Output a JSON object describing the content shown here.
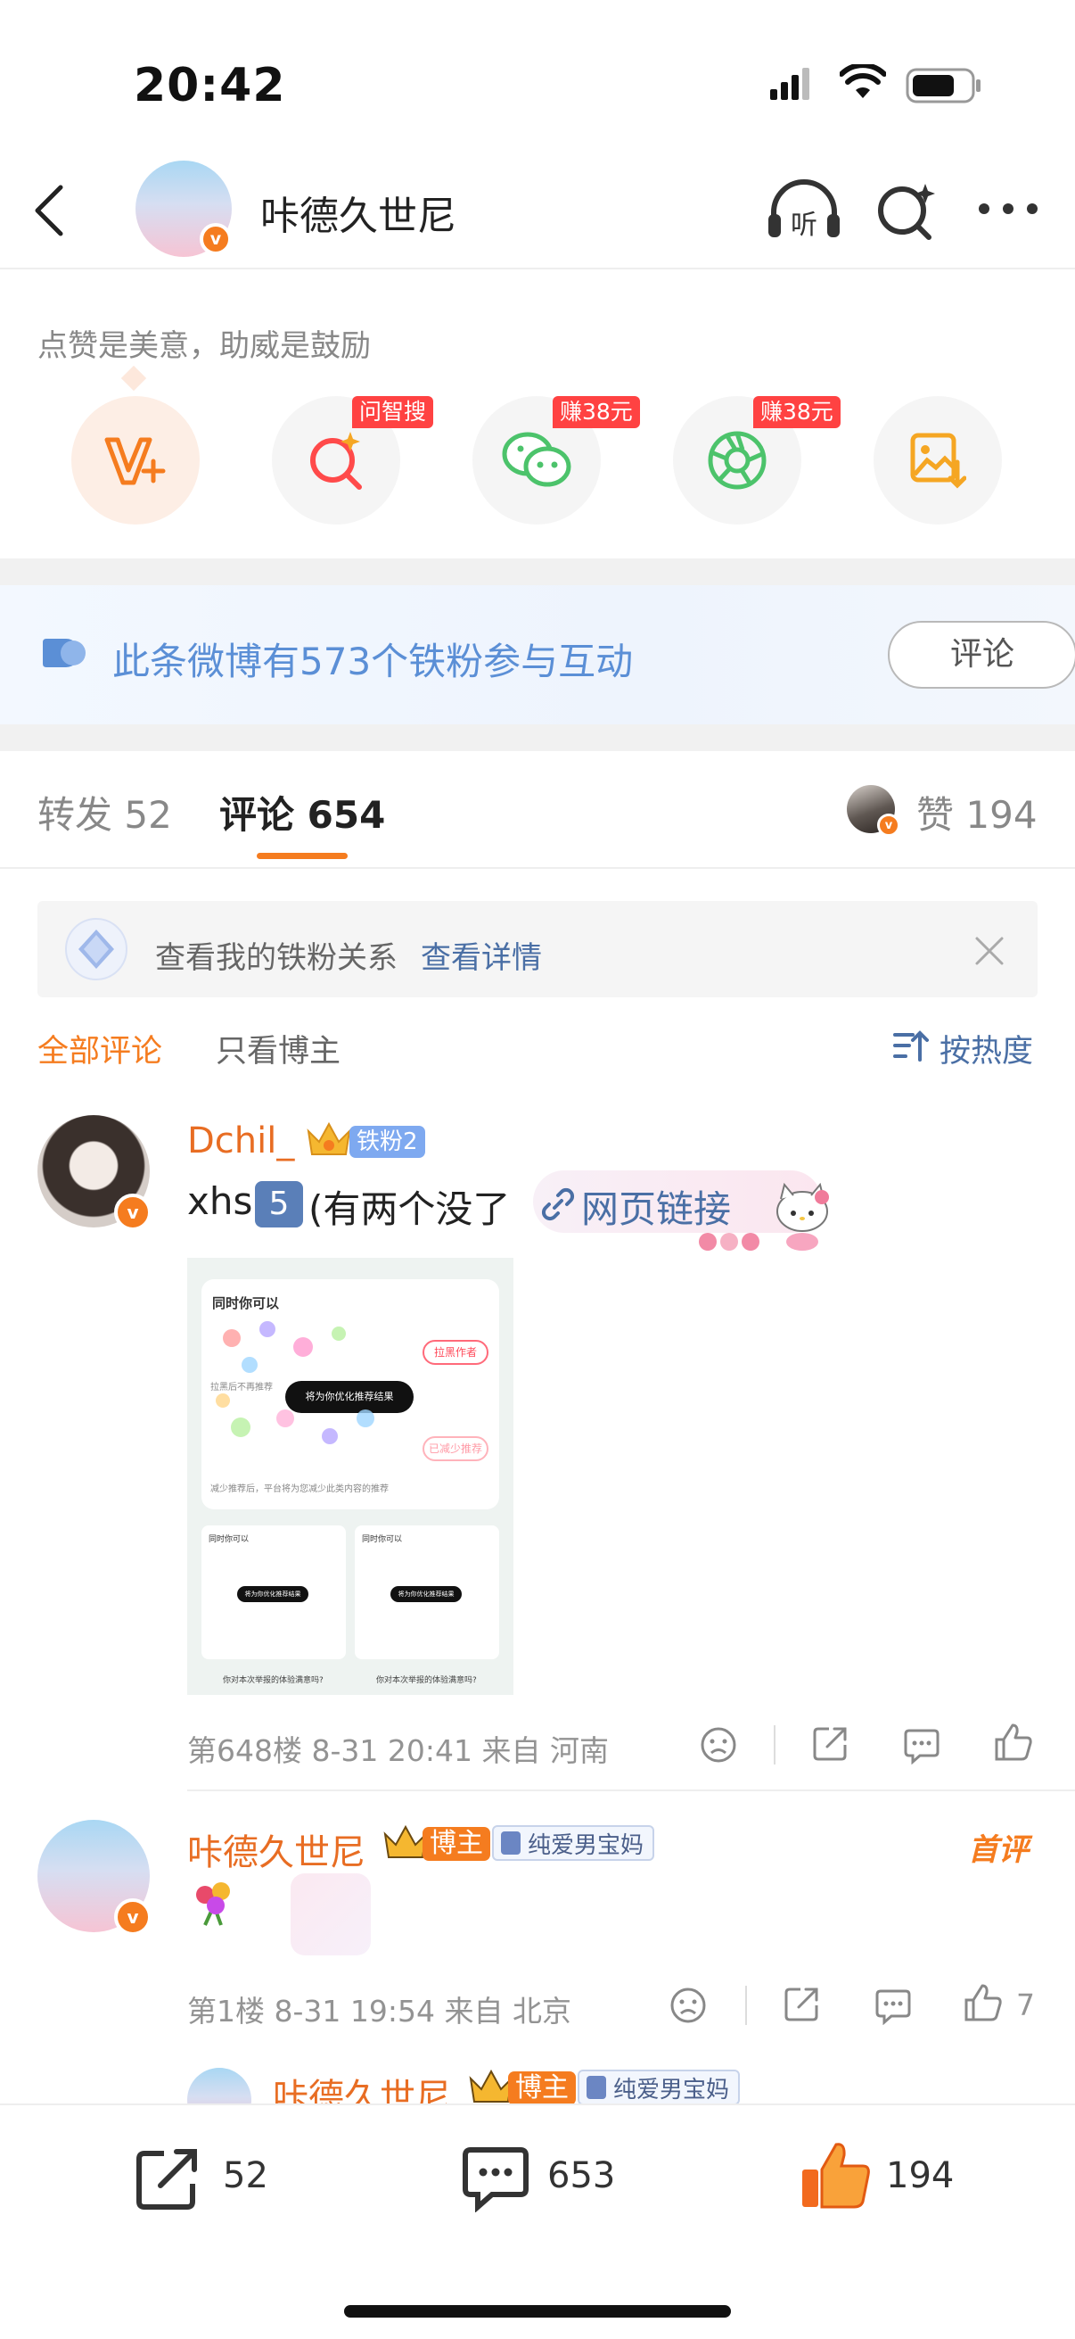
{
  "status_bar": {
    "time": "20:42"
  },
  "header": {
    "title": "咔德久世尼"
  },
  "reward": {
    "hint": "点赞是美意，助威是鼓励"
  },
  "actions": [
    {
      "name": "问智搜",
      "badge": "问智搜"
    },
    {
      "name": "微信",
      "badge": "赚38元"
    },
    {
      "name": "朋友圈",
      "badge": "赚38元"
    }
  ],
  "fans_banner": {
    "text": "此条微博有573个铁粉参与互动",
    "button": "评论"
  },
  "tabs": {
    "repost_label": "转发",
    "repost_count": "52",
    "comment_label": "评论",
    "comment_count": "654",
    "like_label": "赞",
    "like_count": "194"
  },
  "iron_fan_card": {
    "text": "查看我的铁粉关系",
    "link": "查看详情"
  },
  "filter": {
    "all": "全部评论",
    "blogger_only": "只看博主",
    "sort": "按热度"
  },
  "comments": [
    {
      "name": "Dchil_",
      "fan_label": "铁粉2",
      "text_prefix": "xhs",
      "emoji_num": "5",
      "text_suffix": "(有两个没了",
      "link_text": "网页链接",
      "meta": "第648楼 8-31 20:41 来自 河南",
      "likes": ""
    },
    {
      "name": "咔德久世尼",
      "role": "博主",
      "group": "纯爱男宝妈",
      "first_label": "首评",
      "meta": "第1楼 8-31 19:54 来自 北京",
      "likes": "7"
    },
    {
      "name": "咔德久世尼",
      "role": "博主",
      "group": "纯爱男宝妈"
    }
  ],
  "screenshot": {
    "heading": "同时你可以",
    "btn1": "拉黑作者",
    "toast": "将为你优化推荐结果",
    "btn2": "已减少推荐",
    "line1": "拉黑后不再推荐",
    "line2": "减少推荐后，平台将为您减少此类内容的推荐",
    "mini_heading": "同时你可以",
    "mini_toast": "将为你优化推荐结果",
    "mini_q": "你对本次举报的体验满意吗?"
  },
  "bottom_bar": {
    "repost": "52",
    "comment": "653",
    "like": "194"
  },
  "colors": {
    "accent": "#f57c1f",
    "link": "#4a6fa5",
    "banner_text": "#5b8fd6",
    "tab_underline": "#f57c1f"
  }
}
